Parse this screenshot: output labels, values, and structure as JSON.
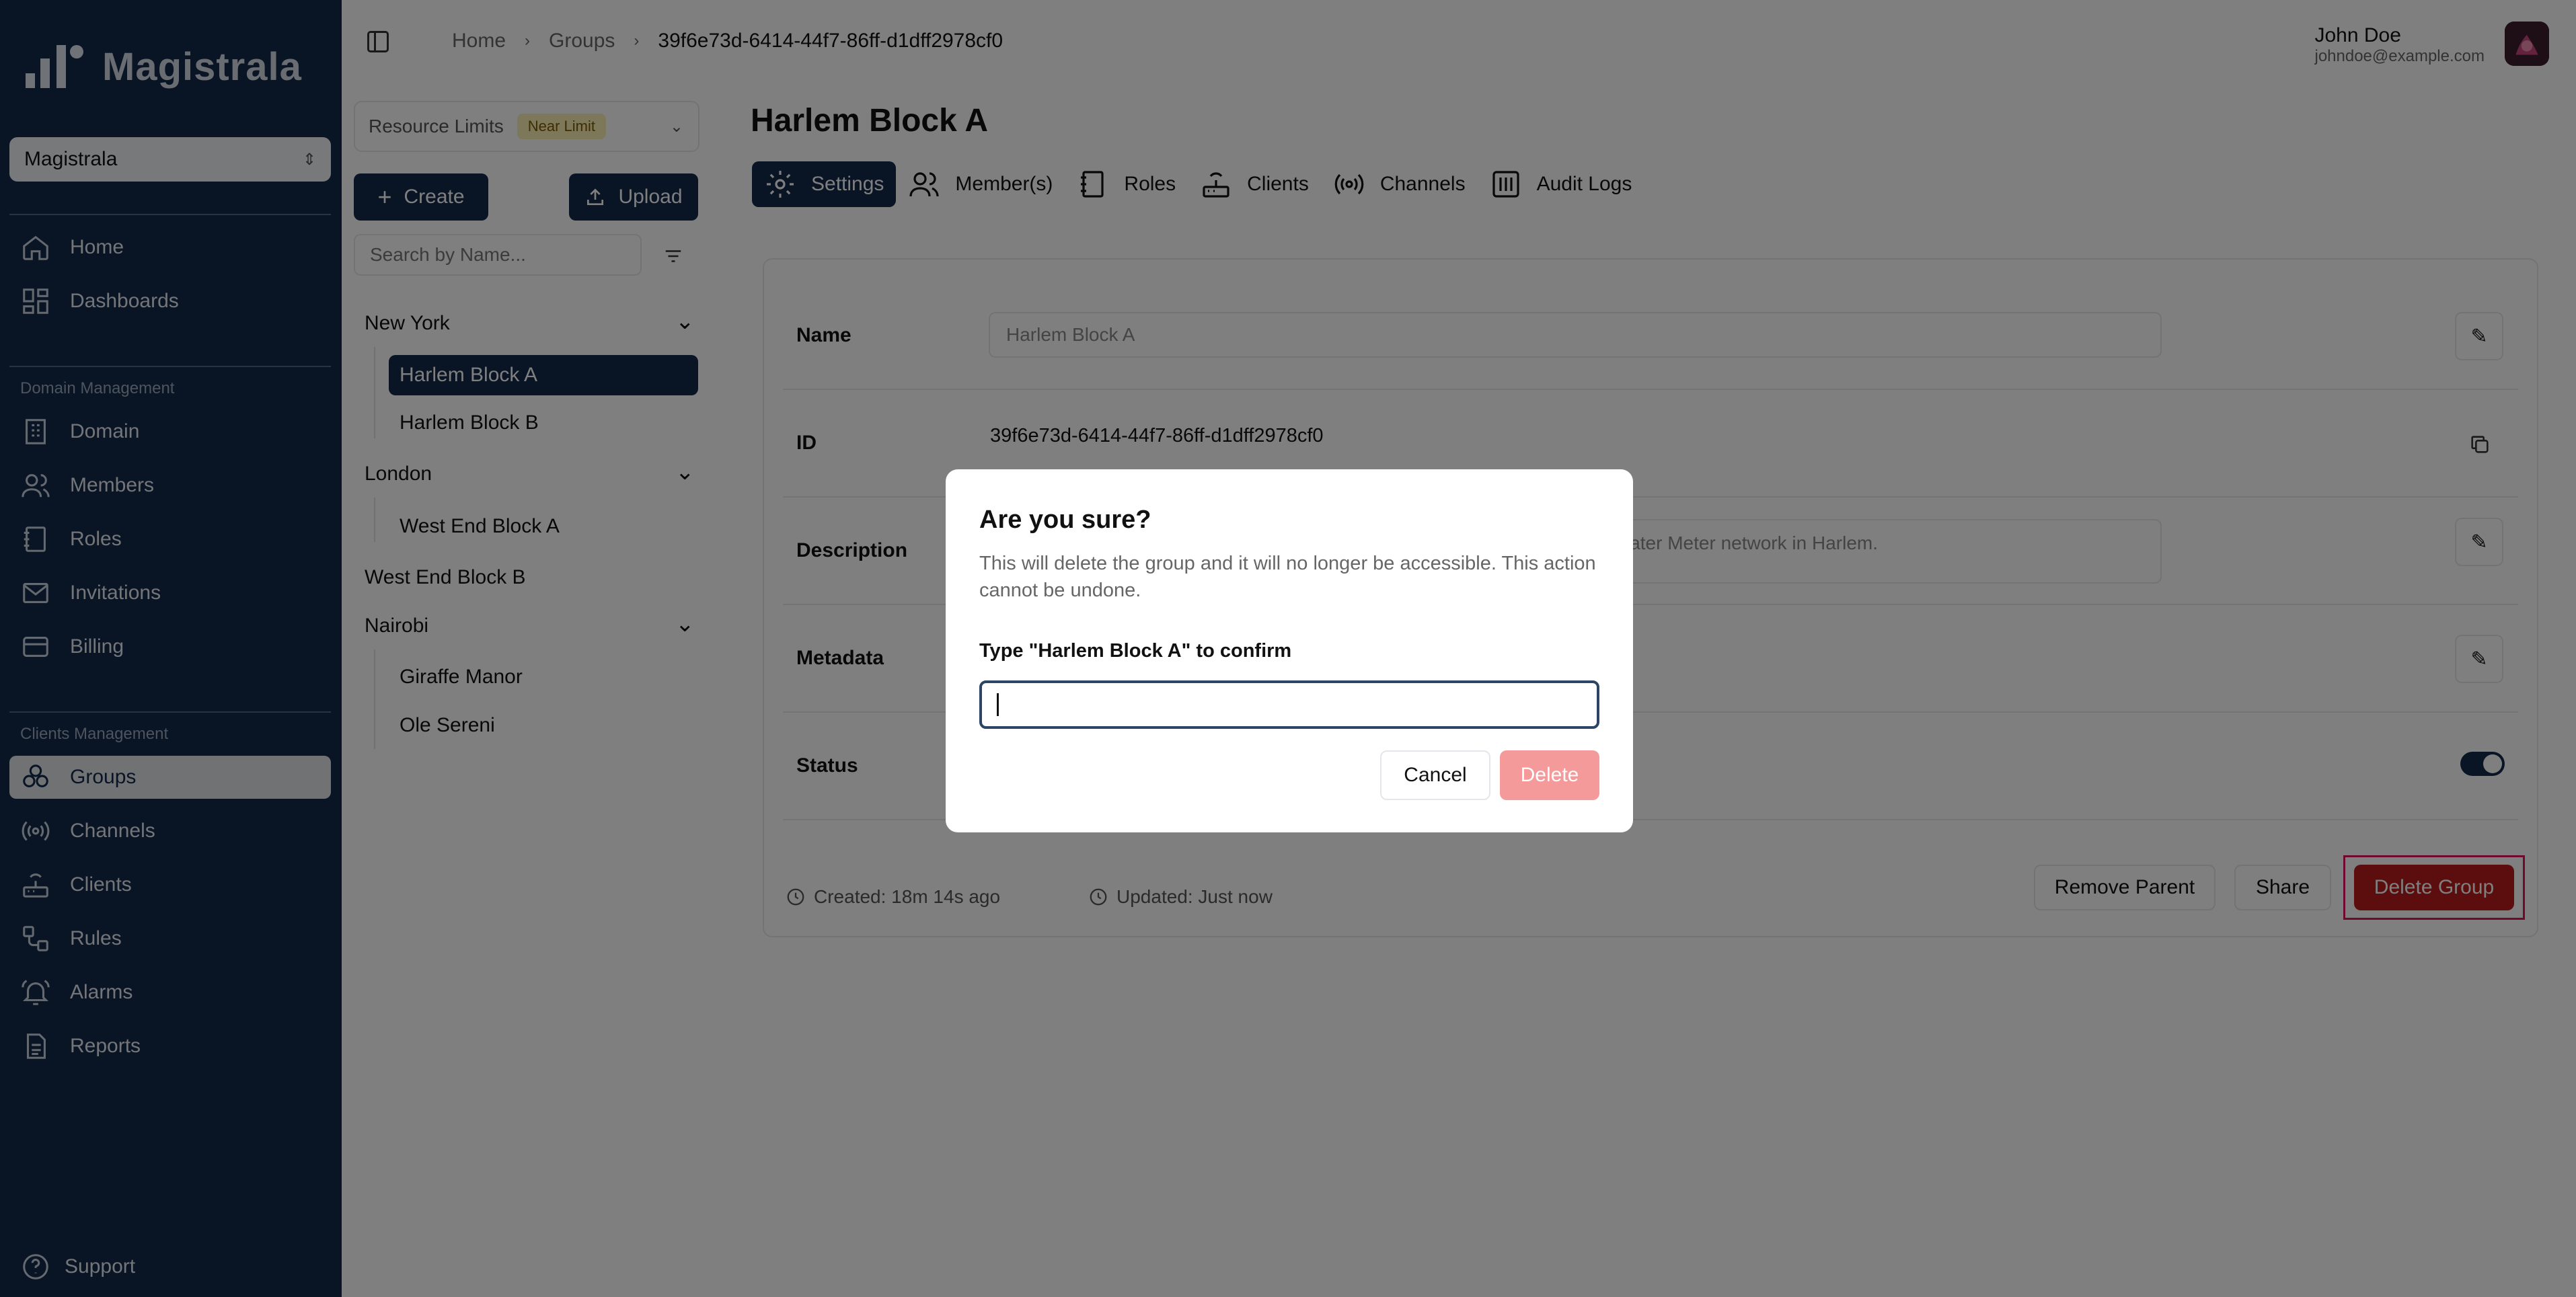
{
  "app": {
    "name": "Magistrala",
    "workspace": "Magistrala"
  },
  "sidebar": {
    "top_items": [
      {
        "label": "Home",
        "icon": "home-icon"
      },
      {
        "label": "Dashboards",
        "icon": "dashboard-icon"
      }
    ],
    "domain_section": "Domain Management",
    "domain_items": [
      {
        "label": "Domain"
      },
      {
        "label": "Members"
      },
      {
        "label": "Roles"
      },
      {
        "label": "Invitations"
      },
      {
        "label": "Billing"
      }
    ],
    "clients_section": "Clients Management",
    "clients_items": [
      {
        "label": "Groups"
      },
      {
        "label": "Channels"
      },
      {
        "label": "Clients"
      },
      {
        "label": "Rules"
      },
      {
        "label": "Alarms"
      },
      {
        "label": "Reports"
      }
    ],
    "support": "Support"
  },
  "breadcrumbs": [
    "Home",
    "Groups",
    "39f6e73d-6414-44f7-86ff-d1dff2978cf0"
  ],
  "user": {
    "name": "John Doe",
    "email": "johndoe@example.com"
  },
  "groups_panel": {
    "resource_limits": "Resource Limits",
    "limit_badge": "Near Limit",
    "create": "Create",
    "upload": "Upload",
    "search_placeholder": "Search by Name...",
    "tree": {
      "new_york": "New York",
      "harlem_a": "Harlem Block A",
      "harlem_b": "Harlem Block B",
      "london": "London",
      "west_end_a": "West End Block A",
      "west_end_b": "West End Block B",
      "nairobi": "Nairobi",
      "giraffe": "Giraffe Manor",
      "ole": "Ole Sereni"
    }
  },
  "page": {
    "title": "Harlem Block A",
    "tabs": [
      "Settings",
      "Member(s)",
      "Roles",
      "Clients",
      "Channels",
      "Audit Logs"
    ],
    "fields": {
      "name_label": "Name",
      "name_value": "Harlem Block A",
      "id_label": "ID",
      "id_value": "39f6e73d-6414-44f7-86ff-d1dff2978cf0",
      "description_label": "Description",
      "description_visible": "ater Meter network in Harlem.",
      "metadata_label": "Metadata",
      "status_label": "Status"
    },
    "status_enabled": true,
    "created": "Created: 18m 14s ago",
    "updated": "Updated: Just now",
    "remove_parent": "Remove Parent",
    "share": "Share",
    "delete_group": "Delete Group"
  },
  "dialog": {
    "title": "Are you sure?",
    "description": "This will delete the group and it will no longer be accessible. This action cannot be undone.",
    "confirm_label": "Type \"Harlem Block A\" to confirm",
    "input_value": "",
    "cancel": "Cancel",
    "delete": "Delete"
  }
}
